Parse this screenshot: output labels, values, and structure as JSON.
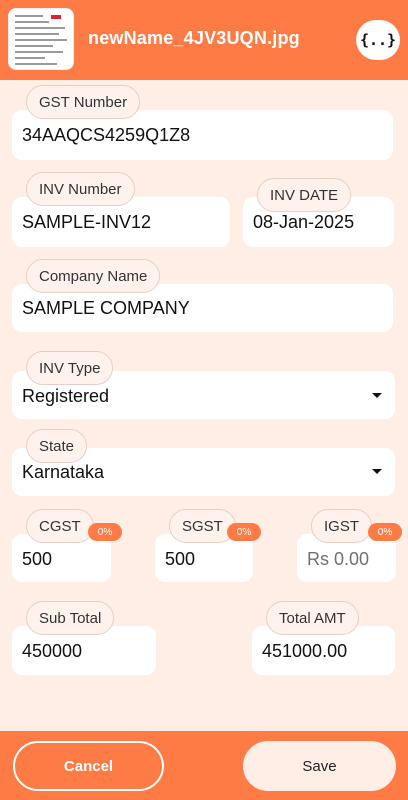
{
  "header": {
    "file_name": "newName_4JV3UQN.jpg",
    "json_icon": "{..}",
    "background_color": "#ff7b45"
  },
  "fields": {
    "gst_number": {
      "label": "GST Number",
      "value": "34AAQCS4259Q1Z8"
    },
    "inv_number": {
      "label": "INV Number",
      "value": "SAMPLE-INV12"
    },
    "inv_date": {
      "label": "INV DATE",
      "value": "08-Jan-2025"
    },
    "company_name": {
      "label": "Company Name",
      "value": "SAMPLE COMPANY"
    },
    "inv_type": {
      "label": "INV Type",
      "value": "Registered"
    },
    "state": {
      "label": "State",
      "value": "Karnataka"
    },
    "cgst": {
      "label": "CGST",
      "value": "500",
      "rate": "0%"
    },
    "sgst": {
      "label": "SGST",
      "value": "500",
      "rate": "0%"
    },
    "igst": {
      "label": "IGST",
      "value": "Rs 0.00",
      "rate": "0%"
    },
    "sub_total": {
      "label": "Sub Total",
      "value": "450000"
    },
    "total_amt": {
      "label": "Total AMT",
      "value": "451000.00"
    }
  },
  "footer": {
    "cancel_label": "Cancel",
    "save_label": "Save"
  },
  "colors": {
    "accent": "#ff7b45",
    "background": "#ffeee6"
  }
}
